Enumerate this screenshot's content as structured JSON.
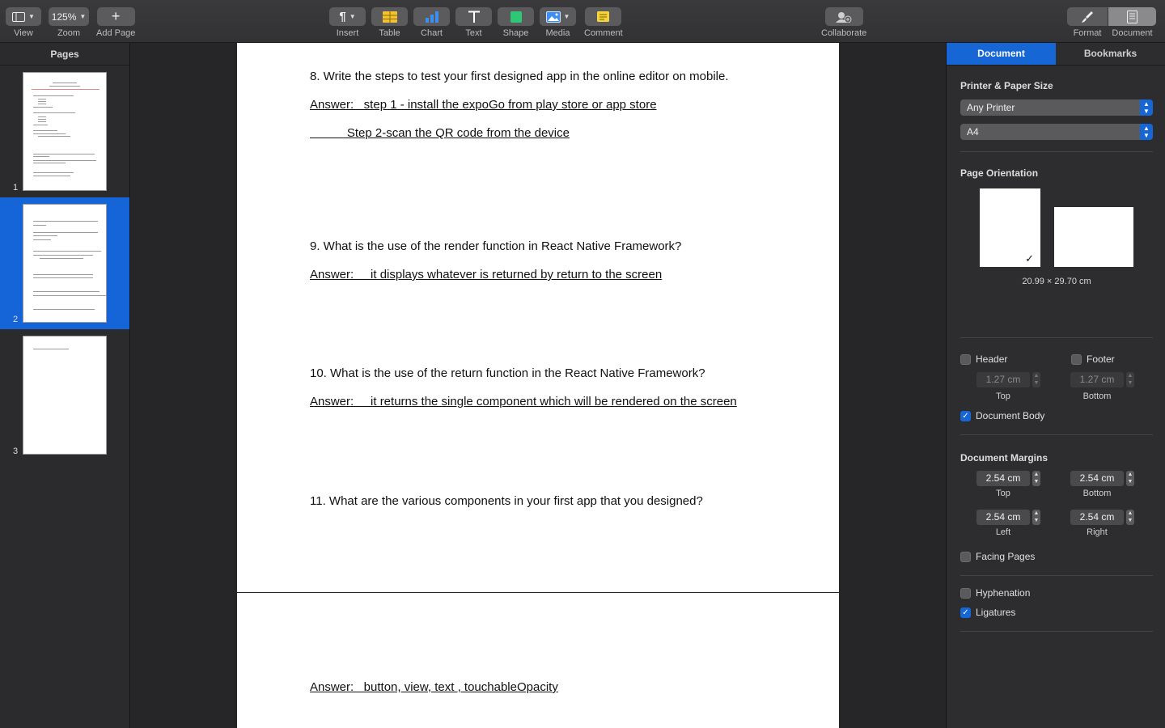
{
  "toolbar": {
    "view": {
      "label": "View"
    },
    "zoom": {
      "label": "Zoom",
      "value": "125%"
    },
    "add_page": {
      "label": "Add Page"
    },
    "insert": {
      "label": "Insert"
    },
    "table": {
      "label": "Table"
    },
    "chart": {
      "label": "Chart"
    },
    "text": {
      "label": "Text"
    },
    "shape": {
      "label": "Shape"
    },
    "media": {
      "label": "Media"
    },
    "comment": {
      "label": "Comment"
    },
    "collaborate": {
      "label": "Collaborate"
    },
    "format": {
      "label": "Format"
    },
    "document": {
      "label": "Document"
    }
  },
  "sidebar": {
    "title": "Pages",
    "pages": [
      {
        "number": "1",
        "selected": false
      },
      {
        "number": "2",
        "selected": true
      },
      {
        "number": "3",
        "selected": false
      }
    ]
  },
  "document": {
    "q8": "8. Write the steps to test your first designed app in the online editor on mobile.",
    "q8_answer_1": "Answer:   step 1 - install the expoGo from play store or app store",
    "q8_answer_2": "           Step 2-scan the QR code from the device",
    "q9": "9. What is the use of the render function in React Native Framework?",
    "q9_answer": "Answer:     it displays whatever is returned by return to the screen",
    "q10": "10. What is the use of the return function in the React Native Framework?",
    "q10_answer": "Answer:     it returns the single component which will be rendered on the screen",
    "q11": "11. What are the various components in your first app that you designed?",
    "q11_answer": "Answer:   button, view, text , touchableOpacity"
  },
  "inspector": {
    "tabs": [
      "Document",
      "Bookmarks"
    ],
    "active_tab": "Document",
    "printer_paper": {
      "title": "Printer & Paper Size",
      "printer": "Any Printer",
      "paper": "A4"
    },
    "orientation": {
      "title": "Page Orientation",
      "size": "20.99 × 29.70 cm",
      "selected": "portrait"
    },
    "header_footer": {
      "header_label": "Header",
      "header_checked": false,
      "footer_label": "Footer",
      "footer_checked": false,
      "header_value": "1.27 cm",
      "footer_value": "1.27 cm",
      "top_label": "Top",
      "bottom_label": "Bottom",
      "body_label": "Document Body",
      "body_checked": true
    },
    "margins": {
      "title": "Document Margins",
      "top": "2.54 cm",
      "bottom": "2.54 cm",
      "left": "2.54 cm",
      "right": "2.54 cm",
      "top_label": "Top",
      "bottom_label": "Bottom",
      "left_label": "Left",
      "right_label": "Right"
    },
    "facing_pages": {
      "label": "Facing Pages",
      "checked": false
    },
    "hyphenation": {
      "label": "Hyphenation",
      "checked": false
    },
    "ligatures": {
      "label": "Ligatures",
      "checked": true
    }
  },
  "colors": {
    "accent": "#1666d6",
    "toolbar_bg": "#3a3a3c",
    "table_icon": "#f2c230",
    "chart_icon": "#3a8ff0",
    "shape_icon": "#2ec776",
    "comment_icon": "#f5d33a"
  }
}
